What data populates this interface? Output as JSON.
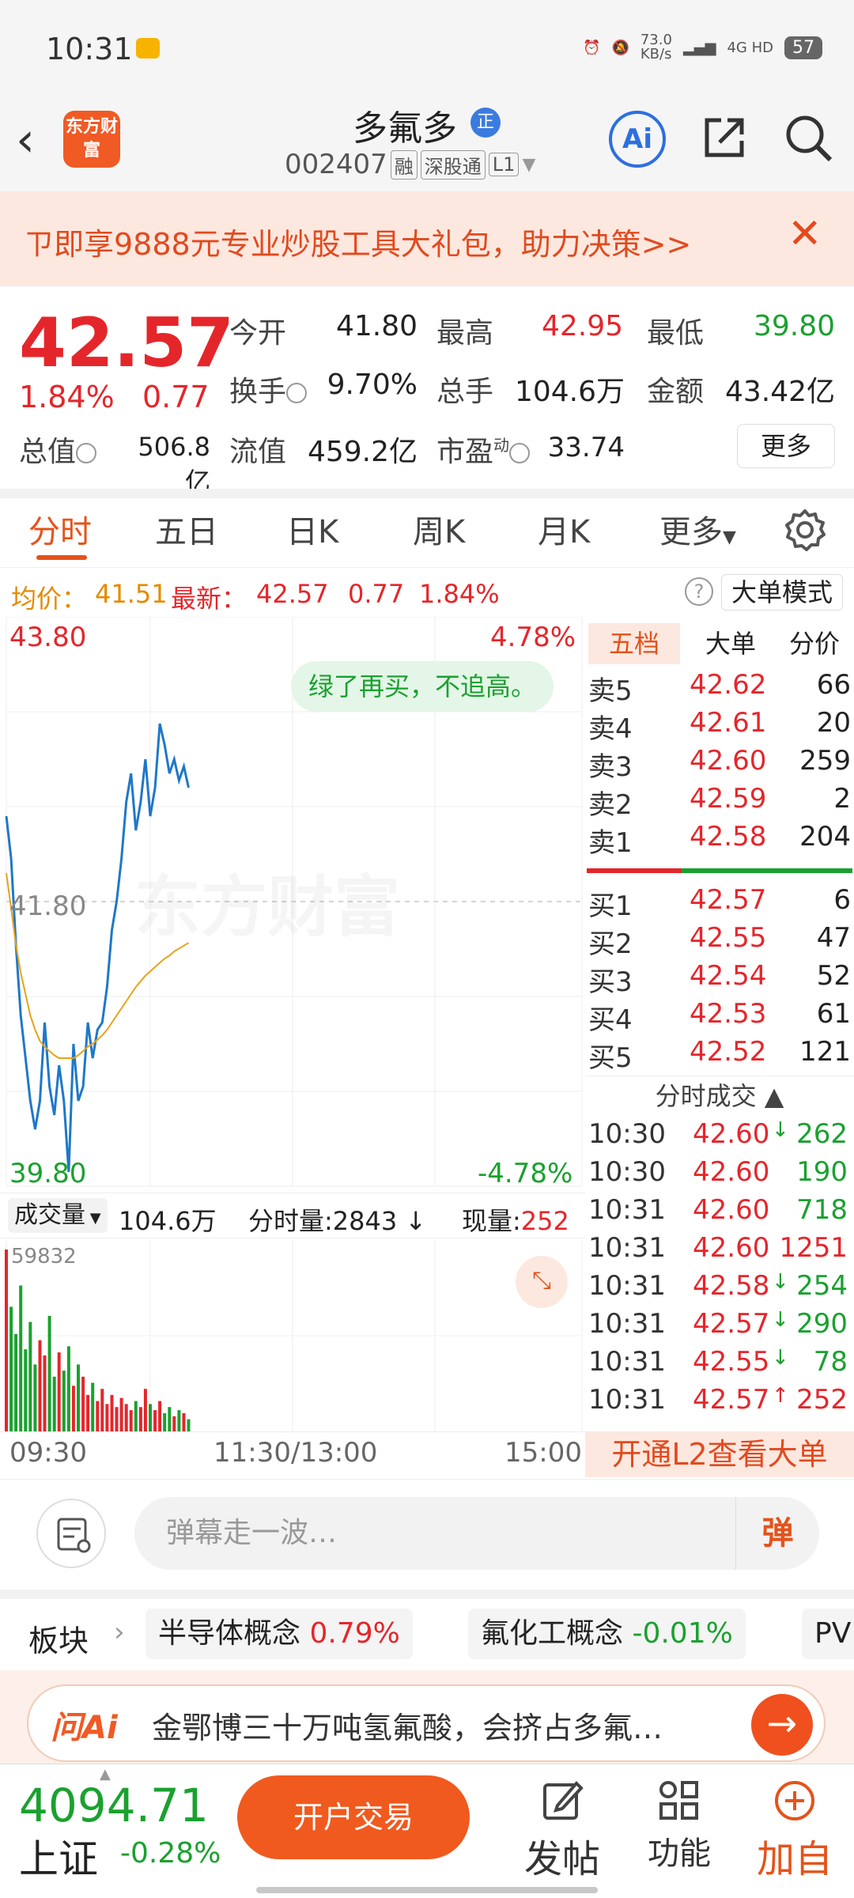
{
  "status_bar": {
    "time": "10:31",
    "net_speed": "73.0\nKB/s",
    "network": "4G HD",
    "battery": "57"
  },
  "header": {
    "stock_name": "多氟多",
    "badge": "正",
    "stock_code": "002407",
    "tags": [
      "融",
      "深股通",
      "L1"
    ],
    "ai_label": "Ai",
    "logo_text": "东方财富"
  },
  "promo": {
    "text": "ㄗ即享9888元专业炒股工具大礼包，助力决策>>"
  },
  "quote": {
    "price": "42.57",
    "change_pct": "1.84%",
    "change": "0.77",
    "fields": [
      {
        "label": "今开",
        "value": "41.80",
        "color": "#222222"
      },
      {
        "label": "最高",
        "value": "42.95",
        "color": "#e4262b"
      },
      {
        "label": "最低",
        "value": "39.80",
        "color": "#1aa12f"
      },
      {
        "label": "换手",
        "value": "9.70%",
        "color": "#222222"
      },
      {
        "label": "总手",
        "value": "104.6万",
        "color": "#222222"
      },
      {
        "label": "金额",
        "value": "43.42亿",
        "color": "#222222"
      },
      {
        "label": "总值",
        "value": "506.8亿",
        "color": "#222222"
      },
      {
        "label": "流值",
        "value": "459.2亿",
        "color": "#222222"
      },
      {
        "label": "市盈",
        "value": "33.74",
        "color": "#222222",
        "sup": "动"
      }
    ],
    "more": "更多"
  },
  "tabs": [
    "分时",
    "五日",
    "日K",
    "周K",
    "月K",
    "更多"
  ],
  "avg_row": {
    "avg_label": "均价：",
    "avg_value": "41.51",
    "last_label": "最新：",
    "last_value": "42.57",
    "chg": "0.77",
    "pct": "1.84%",
    "mode_button": "大单模式"
  },
  "chart": {
    "top_price": "43.80",
    "top_pct": "4.78%",
    "mid_price": "41.80",
    "bottom_price": "39.80",
    "bottom_pct": "-4.78%",
    "tip": "绿了再买，不追高。",
    "watermark": "东方财富",
    "vol_label": "成交量",
    "vol_total": "104.6万",
    "tick_vol_label": "分时量:2843",
    "cur_vol_label": "现量:",
    "cur_vol": "252",
    "vol_max": "59832",
    "time_axis": [
      "09:30",
      "11:30/13:00",
      "15:00"
    ]
  },
  "chart_data": {
    "type": "line",
    "ylim": [
      39.8,
      43.8
    ],
    "xlabel": "",
    "ylabel": "",
    "series": [
      {
        "values": [
          42.4,
          42.1,
          41.5,
          41.0,
          40.7,
          40.4,
          40.2,
          40.4,
          40.95,
          40.5,
          40.3,
          40.65,
          40.4,
          39.9,
          40.8,
          40.4,
          40.5,
          40.95,
          40.7,
          40.9,
          40.95,
          41.2,
          41.6,
          41.8,
          42.1,
          42.5,
          42.7,
          42.3,
          42.5,
          42.8,
          42.4,
          42.6,
          43.05,
          42.9,
          42.7,
          42.8,
          42.65,
          42.75,
          42.6
        ]
      },
      {
        "values": [
          42.0,
          41.75,
          41.5,
          41.3,
          41.15,
          41.0,
          40.9,
          40.82,
          40.78,
          40.75,
          40.72,
          40.7,
          40.7,
          40.7,
          40.7,
          40.72,
          40.75,
          40.78,
          40.8,
          40.83,
          40.86,
          40.9,
          40.95,
          41.0,
          41.05,
          41.1,
          41.15,
          41.2,
          41.24,
          41.28,
          41.31,
          41.34,
          41.37,
          41.4,
          41.42,
          41.45,
          41.47,
          41.49,
          41.51
        ]
      }
    ],
    "volumes": [
      59832,
      41000,
      32000,
      48000,
      27000,
      36000,
      22000,
      30000,
      25000,
      38000,
      18000,
      26000,
      20000,
      28000,
      15000,
      22000,
      18000,
      12000,
      16000,
      10000,
      14000,
      9000,
      12000,
      8000,
      11000,
      9000,
      7000,
      10000,
      8000,
      14000,
      9000,
      7000,
      10000,
      6000,
      8000,
      5000,
      7000,
      6000,
      4000
    ]
  },
  "order_book": {
    "tabs": [
      "五档",
      "大单",
      "分价"
    ],
    "sells": [
      {
        "label": "卖5",
        "price": "42.62",
        "vol": "66"
      },
      {
        "label": "卖4",
        "price": "42.61",
        "vol": "20"
      },
      {
        "label": "卖3",
        "price": "42.60",
        "vol": "259"
      },
      {
        "label": "卖2",
        "price": "42.59",
        "vol": "2"
      },
      {
        "label": "卖1",
        "price": "42.58",
        "vol": "204"
      }
    ],
    "buys": [
      {
        "label": "买1",
        "price": "42.57",
        "vol": "6"
      },
      {
        "label": "买2",
        "price": "42.55",
        "vol": "47"
      },
      {
        "label": "买3",
        "price": "42.54",
        "vol": "52"
      },
      {
        "label": "买4",
        "price": "42.53",
        "vol": "61"
      },
      {
        "label": "买5",
        "price": "42.52",
        "vol": "121"
      }
    ],
    "trades_title": "分时成交",
    "trades": [
      {
        "time": "10:30",
        "price": "42.60",
        "arrow": "↓",
        "vol": "262",
        "color": "#1aa12f"
      },
      {
        "time": "10:30",
        "price": "42.60",
        "arrow": "",
        "vol": "190",
        "color": "#1aa12f"
      },
      {
        "time": "10:31",
        "price": "42.60",
        "arrow": "",
        "vol": "718",
        "color": "#1aa12f"
      },
      {
        "time": "10:31",
        "price": "42.60",
        "arrow": "",
        "vol": "1251",
        "color": "#e4262b"
      },
      {
        "time": "10:31",
        "price": "42.58",
        "arrow": "↓",
        "vol": "254",
        "color": "#1aa12f"
      },
      {
        "time": "10:31",
        "price": "42.57",
        "arrow": "↓",
        "vol": "290",
        "color": "#1aa12f"
      },
      {
        "time": "10:31",
        "price": "42.55",
        "arrow": "↓",
        "vol": "78",
        "color": "#1aa12f"
      },
      {
        "time": "10:31",
        "price": "42.57",
        "arrow": "↑",
        "vol": "252",
        "color": "#e4262b"
      }
    ],
    "l2_button": "开通L2查看大单"
  },
  "bullet": {
    "placeholder": "弹幕走一波…",
    "button": "弹"
  },
  "sectors": {
    "label": "板块",
    "items": [
      {
        "name": "半导体概念",
        "pct": "0.79%",
        "color": "#e4262b"
      },
      {
        "name": "氟化工概念",
        "pct": "-0.01%",
        "color": "#1aa12f"
      },
      {
        "name": "PV",
        "pct": "",
        "color": "#222222"
      }
    ]
  },
  "ask_ai": {
    "logo": "问Ai",
    "text": "金鄂博三十万吨氢氟酸，会挤占多氟…"
  },
  "bottom_bar": {
    "index_value": "4094.71",
    "index_name": "上证",
    "index_pct": "-0.28%",
    "trade_button": "开户交易",
    "nav": [
      "发帖",
      "功能",
      "加自"
    ]
  },
  "colors": {
    "up": "#e4262b",
    "down": "#1aa12f",
    "accent": "#f05a1e",
    "price_line": "#1f78c8",
    "avg_line": "#e8a317"
  }
}
